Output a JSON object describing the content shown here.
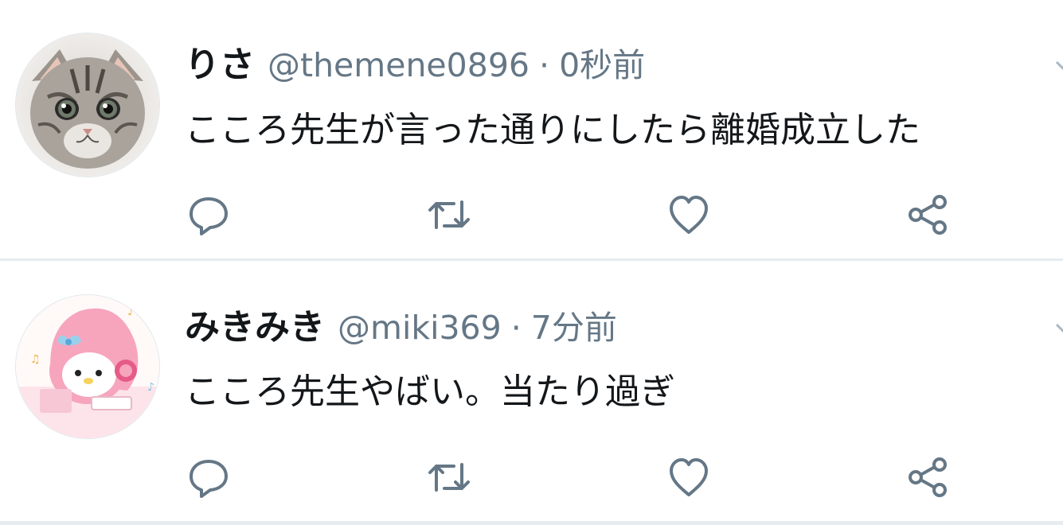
{
  "tweets": [
    {
      "name": "りさ",
      "handle": "@themene0896",
      "separator": "·",
      "time": "0秒前",
      "text": "こころ先生が言った通りにしたら離婚成立した",
      "avatar": "cat-photo",
      "actions": [
        "reply-icon",
        "retweet-icon",
        "like-icon",
        "share-icon"
      ]
    },
    {
      "name": "みきみき",
      "handle": "@miki369",
      "separator": "·",
      "time": "7分前",
      "text": "こころ先生やばい。当たり過ぎ",
      "avatar": "my-melody-illustration",
      "actions": [
        "reply-icon",
        "retweet-icon",
        "like-icon",
        "share-icon"
      ]
    }
  ],
  "colors": {
    "text": "#14171a",
    "meta": "#657786",
    "divider": "#e6ecf0"
  }
}
